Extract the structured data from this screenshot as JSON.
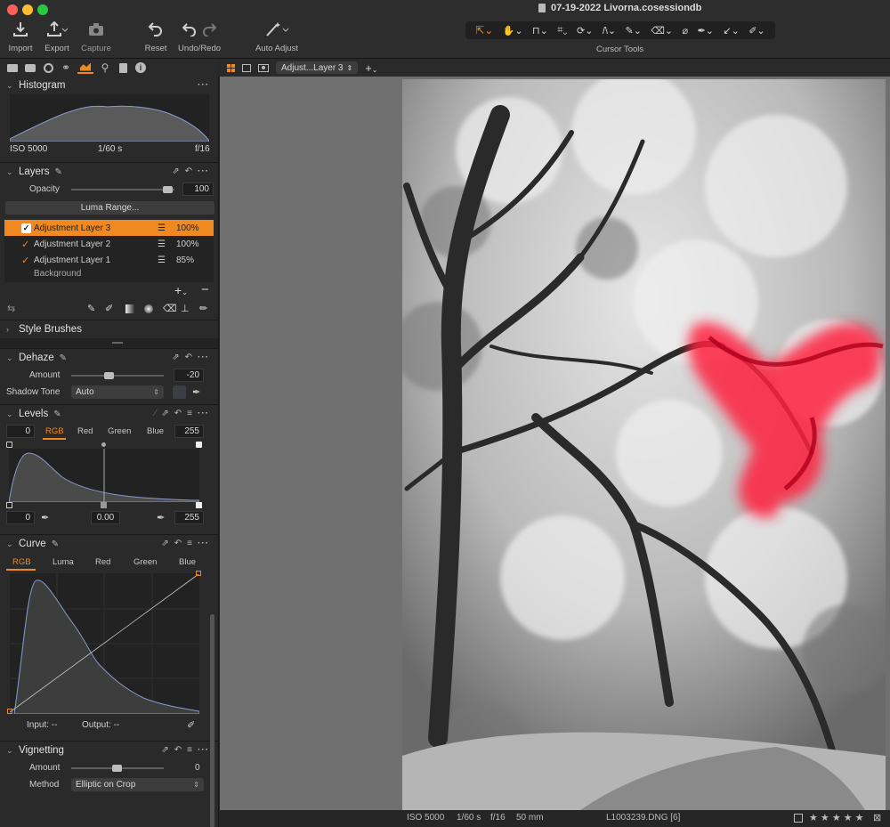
{
  "window": {
    "title": "07-19-2022 Livorna.cosessiondb"
  },
  "toolbar": {
    "import": "Import",
    "export": "Export",
    "capture": "Capture",
    "reset": "Reset",
    "undo_redo": "Undo/Redo",
    "auto_adjust": "Auto Adjust",
    "cursor_tools": "Cursor Tools"
  },
  "viewer_bar": {
    "layer_selector": "Adjust...Layer 3"
  },
  "histogram": {
    "title": "Histogram",
    "iso": "ISO 5000",
    "shutter": "1/60 s",
    "aperture": "f/16"
  },
  "layers": {
    "title": "Layers",
    "opacity_label": "Opacity",
    "opacity_value": "100",
    "opacity": 0.96,
    "luma_range": "Luma Range...",
    "items": [
      {
        "name": "Adjustment Layer 3",
        "pct": "100%",
        "selected": true
      },
      {
        "name": "Adjustment Layer 2",
        "pct": "100%",
        "selected": false
      },
      {
        "name": "Adjustment Layer 1",
        "pct": "85%",
        "selected": false
      }
    ],
    "background_partial": "Background"
  },
  "style_brushes": {
    "title": "Style Brushes"
  },
  "dehaze": {
    "title": "Dehaze",
    "amount_label": "Amount",
    "amount_value": "-20",
    "shadow_tone_label": "Shadow Tone",
    "shadow_tone_value": "Auto"
  },
  "levels": {
    "title": "Levels",
    "left_value": "0",
    "right_value": "255",
    "tabs": [
      "RGB",
      "Red",
      "Green",
      "Blue"
    ],
    "active_tab": "RGB",
    "out_low": "0",
    "midtone": "0.00",
    "out_high": "255"
  },
  "curve": {
    "title": "Curve",
    "tabs": [
      "RGB",
      "Luma",
      "Red",
      "Green",
      "Blue"
    ],
    "active_tab": "RGB",
    "input_label": "Input: --",
    "output_label": "Output: --"
  },
  "vignetting": {
    "title": "Vignetting",
    "amount_label": "Amount",
    "amount_value": "0",
    "method_label": "Method",
    "method_value": "Elliptic on Crop"
  },
  "status": {
    "iso": "ISO 5000",
    "shutter": "1/60 s",
    "aperture": "f/16",
    "focal": "50 mm",
    "filename": "L1003239.DNG [6]",
    "stars": "★ ★ ★ ★ ★"
  },
  "colors": {
    "accent": "#f0891f",
    "mask": "#ff2040"
  }
}
